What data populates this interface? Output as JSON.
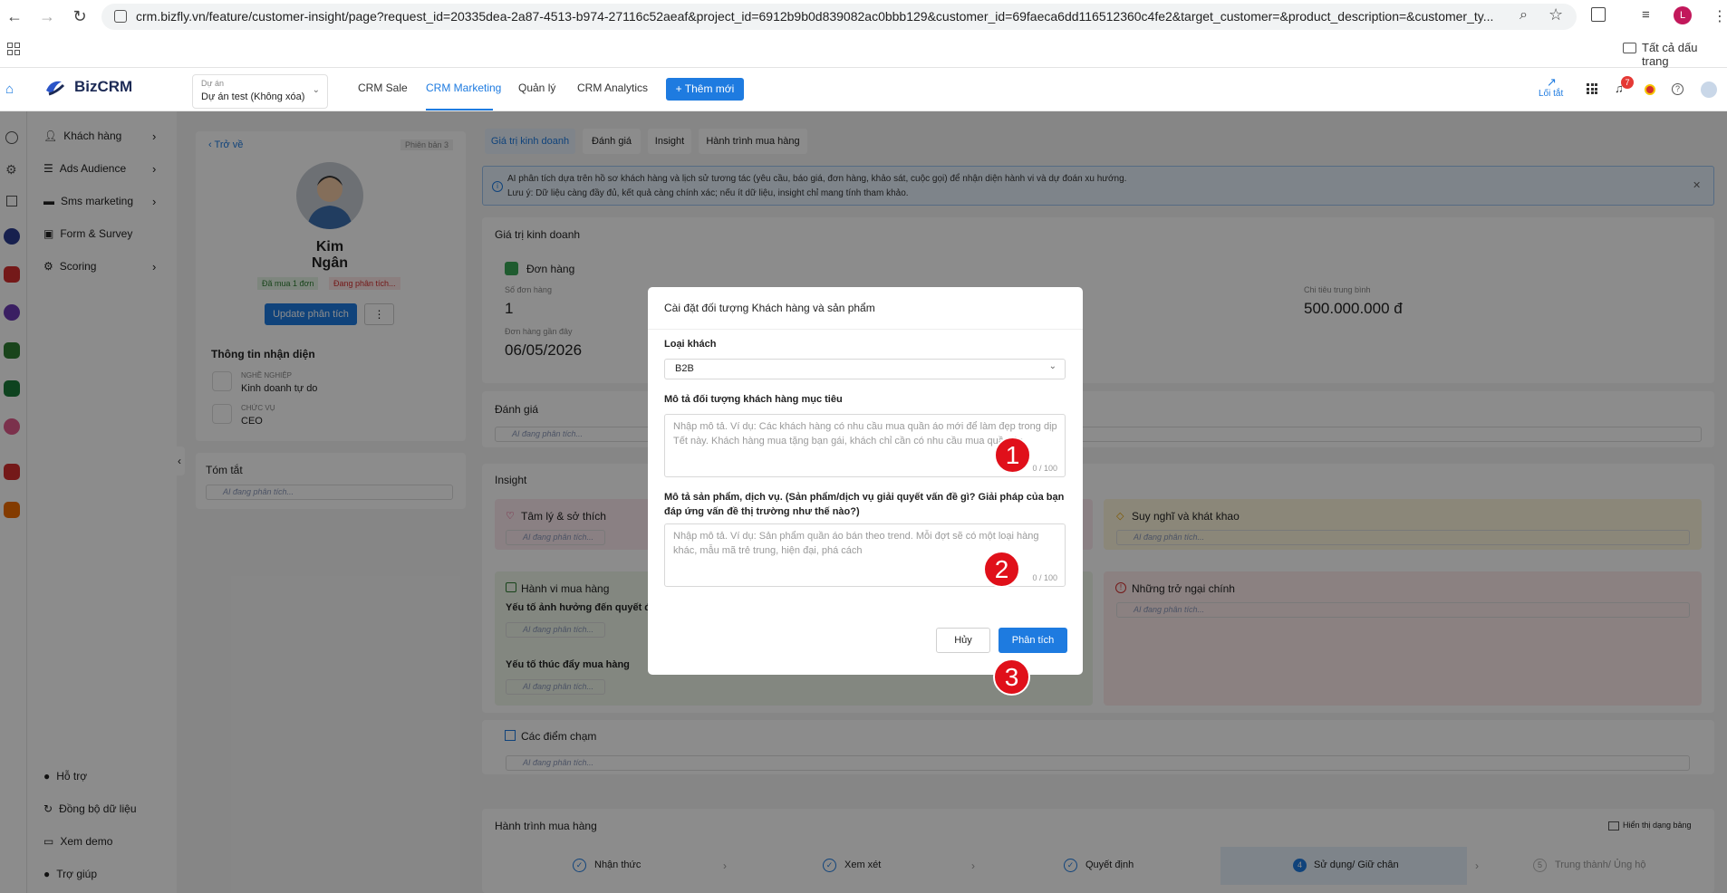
{
  "browser": {
    "url": "crm.bizfly.vn/feature/customer-insight/page?request_id=20335dea-2a87-4513-b974-27116c52aeaf&project_id=6912b9b0d839082ac0bbb129&customer_id=69faeca6dd116512360c4fe2&target_customer=&product_description=&customer_ty...",
    "bookmarks_label": "Tất cả dấu trang",
    "profile_initial": "L"
  },
  "header": {
    "logo": "BizCRM",
    "project_label": "Dự án",
    "project_value": "Dự án test (Không xóa)",
    "nav": [
      "CRM Sale",
      "CRM Marketing",
      "Quản lý",
      "CRM Analytics"
    ],
    "add_button": "+ Thêm mới",
    "shortcut_label": "Lối tắt",
    "notification_count": "7"
  },
  "sidebar": {
    "items": [
      "Khách hàng",
      "Ads Audience",
      "Sms marketing",
      "Form & Survey",
      "Scoring"
    ],
    "bottom": [
      "Hỗ trợ",
      "Đồng bộ dữ liệu",
      "Xem demo",
      "Trợ giúp"
    ]
  },
  "profile": {
    "back": "Trở về",
    "version": "Phiên bản 3",
    "name": "Kim Ngân",
    "tag_bought": "Đã mua 1 đơn",
    "tag_analyzing": "Đang phân tích...",
    "update_button": "Update phân tích",
    "identity_title": "Thông tin nhận diện",
    "job_label": "NGHỀ NGHIỆP",
    "job_value": "Kinh doanh tự do",
    "position_label": "CHỨC VỤ",
    "position_value": "CEO",
    "summary_title": "Tóm tắt",
    "analyzing": "AI đang phân tích..."
  },
  "tabs": [
    "Giá trị kinh doanh",
    "Đánh giá",
    "Insight",
    "Hành trình mua hàng"
  ],
  "alert": {
    "line1": "AI phân tích dựa trên hồ sơ khách hàng và lịch sử tương tác (yêu cầu, báo giá, đơn hàng, khảo sát, cuộc gọi) để nhận diện hành vi và dự đoán xu hướng.",
    "line2": "Lưu ý: Dữ liệu càng đầy đủ, kết quả càng chính xác; nếu ít dữ liệu, insight chỉ mang tính tham khảo."
  },
  "business": {
    "title": "Giá trị kinh doanh",
    "orders_title": "Đơn hàng",
    "order_count_label": "Số đơn hàng",
    "order_count": "1",
    "recent_label": "Đơn hàng gần đây",
    "recent_value": "06/05/2026",
    "avg_label": "Chi tiêu trung bình",
    "avg_value": "500.000.000 đ"
  },
  "evaluation": {
    "title": "Đánh giá"
  },
  "insight": {
    "title": "Insight",
    "psych": "Tâm lý & sở thích",
    "thoughts": "Suy nghĩ và khát khao",
    "behavior": "Hành vi mua hàng",
    "factor_influence": "Yếu tố ảnh hưởng đến quyết định",
    "factor_drive": "Yếu tố thúc đẩy mua hàng",
    "obstacles": "Những trở ngại chính"
  },
  "touchpoints": {
    "title": "Các điểm chạm"
  },
  "journey": {
    "title": "Hành trình mua hàng",
    "table_view": "Hiển thị dạng bảng",
    "steps": [
      "Nhận thức",
      "Xem xét",
      "Quyết định",
      "Sử dụng/ Giữ chân",
      "Trung thành/ Ủng hộ"
    ],
    "step4_num": "4",
    "step5_num": "5"
  },
  "modal": {
    "title": "Cài đặt đối tượng Khách hàng và sản phẩm",
    "customer_type_label": "Loại khách",
    "customer_type_value": "B2B",
    "target_label": "Mô tả đối tượng khách hàng mục tiêu",
    "target_placeholder": "Nhập mô tả. Ví dụ: Các khách hàng có nhu cầu mua quần áo mới để làm đẹp trong dịp Tết này. Khách hàng mua tặng bạn gái, khách chỉ cần có nhu cầu mua quần áo",
    "target_counter": "0 / 100",
    "product_label": "Mô tả sản phẩm, dịch vụ. (Sản phẩm/dịch vụ giải quyết vấn đề gì? Giải pháp của bạn đáp ứng vấn đề thị trường như thế nào?)",
    "product_placeholder": "Nhập mô tả. Ví dụ: Sản phẩm quần áo bán theo trend. Mỗi đợt sẽ có một loại hàng khác, mẫu mã trẻ trung, hiện đại, phá cách",
    "product_counter": "0 / 100",
    "cancel": "Hủy",
    "submit": "Phân tích"
  },
  "annotations": [
    "1",
    "2",
    "3"
  ]
}
